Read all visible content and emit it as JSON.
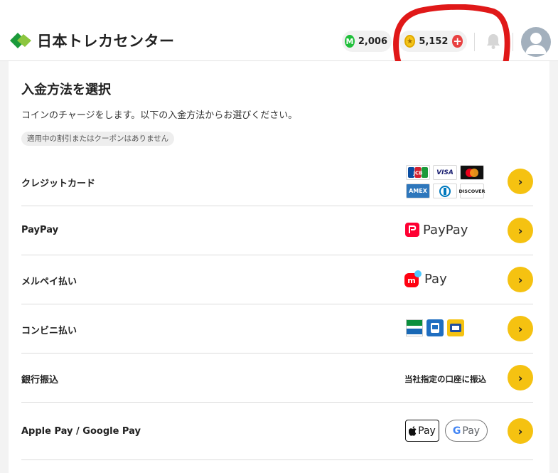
{
  "header": {
    "brand": "日本トレカセンター",
    "m_balance": "2,006",
    "m_icon_letter": "M",
    "coin_balance": "5,152",
    "icons": [
      "logo-icon",
      "m-point-icon",
      "coin-icon",
      "plus-icon",
      "bell-icon",
      "avatar-icon"
    ]
  },
  "page": {
    "title": "入金方法を選択",
    "description": "コインのチャージをします。以下の入金方法からお選びください。",
    "coupon_notice": "適用中の割引またはクーポンはありません"
  },
  "methods": [
    {
      "label": "クレジットカード",
      "brands": [
        "JCB",
        "VISA",
        "AMEX",
        "DISCOVER"
      ]
    },
    {
      "label": "PayPay",
      "logo_text": "PayPay"
    },
    {
      "label": "メルペイ払い",
      "logo_text": "Pay",
      "logo_mark": "m"
    },
    {
      "label": "コンビニ払い"
    },
    {
      "label": "銀行振込",
      "note": "当社指定の口座に振込"
    },
    {
      "label": "Apple Pay / Google Pay",
      "apple": "Pay",
      "google": "Pay",
      "google_g": "G"
    }
  ],
  "colors": {
    "accent_yellow": "#f5c211",
    "annotation_red": "#e01818",
    "m_green": "#1fbf3a",
    "plus_red": "#e84040",
    "brand_green": "#1b9a3a"
  }
}
